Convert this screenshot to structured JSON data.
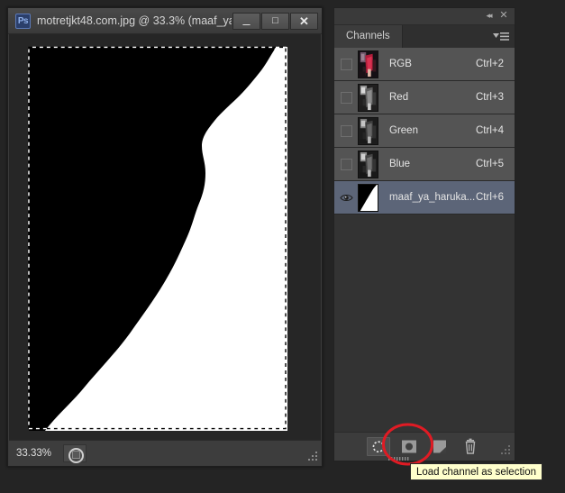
{
  "document_window": {
    "app_logo": "Ps",
    "title": "motretjkt48.com.jpg @ 33.3% (maaf_ya...",
    "window_controls": {
      "minimize": "—",
      "maximize": "❐",
      "close": "✕"
    },
    "status_bar": {
      "zoom": "33.33%",
      "doc_info_icon": "document-thumbnail-icon"
    },
    "canvas": {
      "description": "black-and-white alpha channel mask with active selection marching ants",
      "background_color": "#000000",
      "mask_color": "#ffffff"
    }
  },
  "channels_panel": {
    "topbar": {
      "collapse_icon": "collapse-to-icons-icon",
      "close_icon": "close-panel-icon"
    },
    "tab_label": "Channels",
    "menu_icon": "panel-menu-icon",
    "channels": [
      {
        "name": "RGB",
        "shortcut": "Ctrl+2",
        "visible": false,
        "selected": false,
        "thumb": "rgb-color"
      },
      {
        "name": "Red",
        "shortcut": "Ctrl+3",
        "visible": false,
        "selected": false,
        "thumb": "gray"
      },
      {
        "name": "Green",
        "shortcut": "Ctrl+4",
        "visible": false,
        "selected": false,
        "thumb": "gray"
      },
      {
        "name": "Blue",
        "shortcut": "Ctrl+5",
        "visible": false,
        "selected": false,
        "thumb": "gray"
      },
      {
        "name": "maaf_ya_haruka...",
        "shortcut": "Ctrl+6",
        "visible": true,
        "selected": true,
        "thumb": "mask"
      }
    ],
    "bottom_buttons": [
      {
        "icon": "load-channel-as-selection-icon",
        "active": true
      },
      {
        "icon": "save-selection-as-channel-icon",
        "active": false
      },
      {
        "icon": "new-channel-icon",
        "active": false
      },
      {
        "icon": "delete-channel-icon",
        "active": false
      }
    ]
  },
  "annotation": {
    "ellipse_color": "#e01b24",
    "tooltip_text": "Load channel as selection",
    "tooltip_bg": "#ffffcc"
  }
}
